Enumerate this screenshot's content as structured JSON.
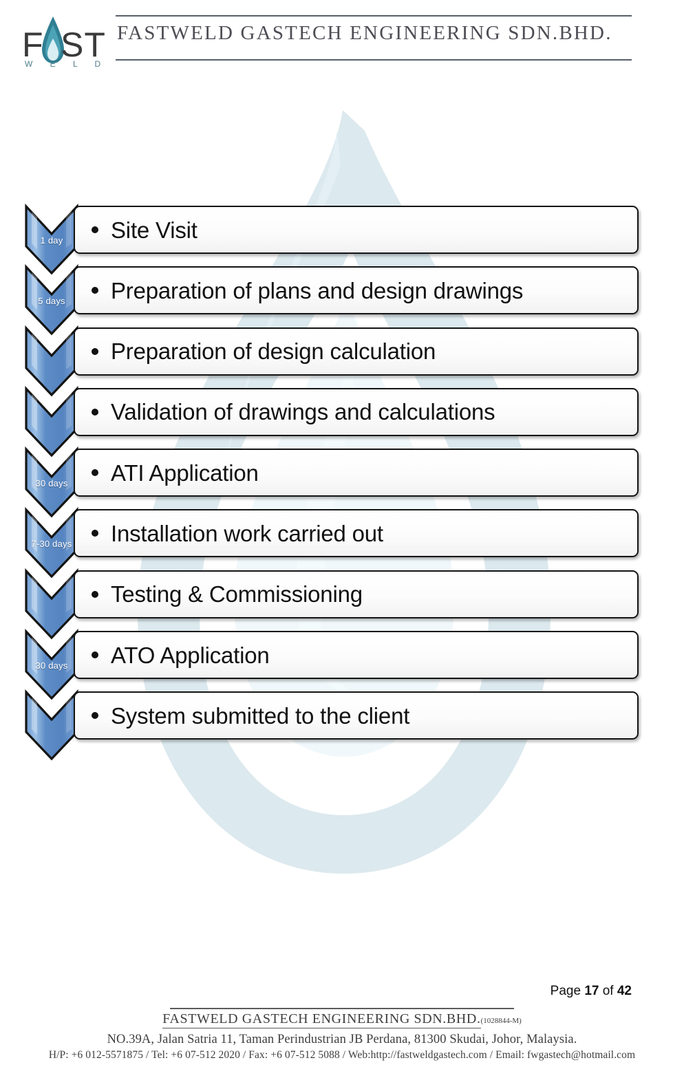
{
  "header": {
    "logo": {
      "mark_left": "F",
      "mark_right": "ST",
      "sub": "W E L D",
      "drop_icon": "water-drop-icon"
    },
    "company_title": "FASTWELD GASTECH ENGINEERING SDN.BHD."
  },
  "flow": {
    "steps": [
      {
        "duration": "1 day",
        "text": "Site Visit"
      },
      {
        "duration": "5 days",
        "text": "Preparation of plans and design drawings"
      },
      {
        "duration": "",
        "text": "Preparation of design calculation"
      },
      {
        "duration": "",
        "text": "Validation of drawings and calculations"
      },
      {
        "duration": "30 days",
        "text": "ATI Application"
      },
      {
        "duration": "7-30  days",
        "text": "Installation work carried out"
      },
      {
        "duration": "",
        "text": "Testing & Commissioning"
      },
      {
        "duration": "30 days",
        "text": "ATO Application"
      },
      {
        "duration": "",
        "text": "System submitted to the client"
      }
    ]
  },
  "page_number": {
    "prefix": "Page ",
    "current": "17",
    "middle": " of ",
    "total": "42"
  },
  "footer": {
    "company": "FASTWELD GASTECH ENGINEERING SDN.BHD.",
    "reg_no": "(1028844-M)",
    "address": "NO.39A, Jalan Satria 11, Taman Perindustrian JB Perdana, 81300 Skudai, Johor, Malaysia.",
    "contact": "H/P: +6 012-5571875 / Tel: +6 07-512 2020 /  Fax:  +6 07-512 5088  /  Web:http://fastweldgastech.com / Email: fwgastech@hotmail.com"
  },
  "colors": {
    "chevron_blue_dark": "#4f7fc0",
    "chevron_blue_light": "#a8c8ea",
    "watermark": "#dce9ee",
    "logo_teal": "#2f7f92",
    "text_dark": "#111111"
  }
}
